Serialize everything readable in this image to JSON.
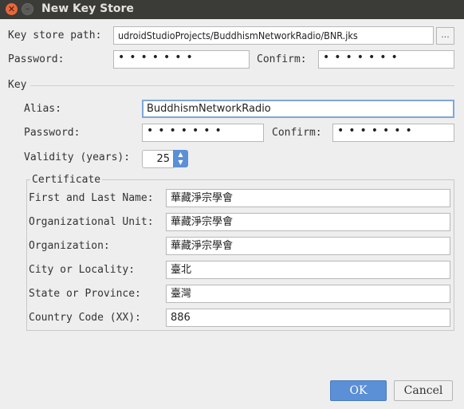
{
  "window": {
    "title": "New Key Store"
  },
  "keystore": {
    "path_label": "Key store path:",
    "path_value": "udroidStudioProjects/BuddhismNetworkRadio/BNR.jks",
    "browse_label": "...",
    "password_label": "Password:",
    "password_value": "•••••••",
    "confirm_label": "Confirm:",
    "confirm_value": "•••••••"
  },
  "key": {
    "section_label": "Key",
    "alias_label": "Alias:",
    "alias_value": "BuddhismNetworkRadio",
    "password_label": "Password:",
    "password_value": "•••••••",
    "confirm_label": "Confirm:",
    "confirm_value": "•••••••",
    "validity_label": "Validity (years):",
    "validity_value": "25"
  },
  "certificate": {
    "group_label": "Certificate",
    "fields": [
      {
        "label": "First and Last Name:",
        "value": "華藏淨宗學會"
      },
      {
        "label": "Organizational Unit:",
        "value": "華藏淨宗學會"
      },
      {
        "label": "Organization:",
        "value": "華藏淨宗學會"
      },
      {
        "label": "City or Locality:",
        "value": "臺北"
      },
      {
        "label": "State or Province:",
        "value": "臺灣"
      },
      {
        "label": "Country Code (XX):",
        "value": "886"
      }
    ]
  },
  "buttons": {
    "ok": "OK",
    "cancel": "Cancel"
  }
}
